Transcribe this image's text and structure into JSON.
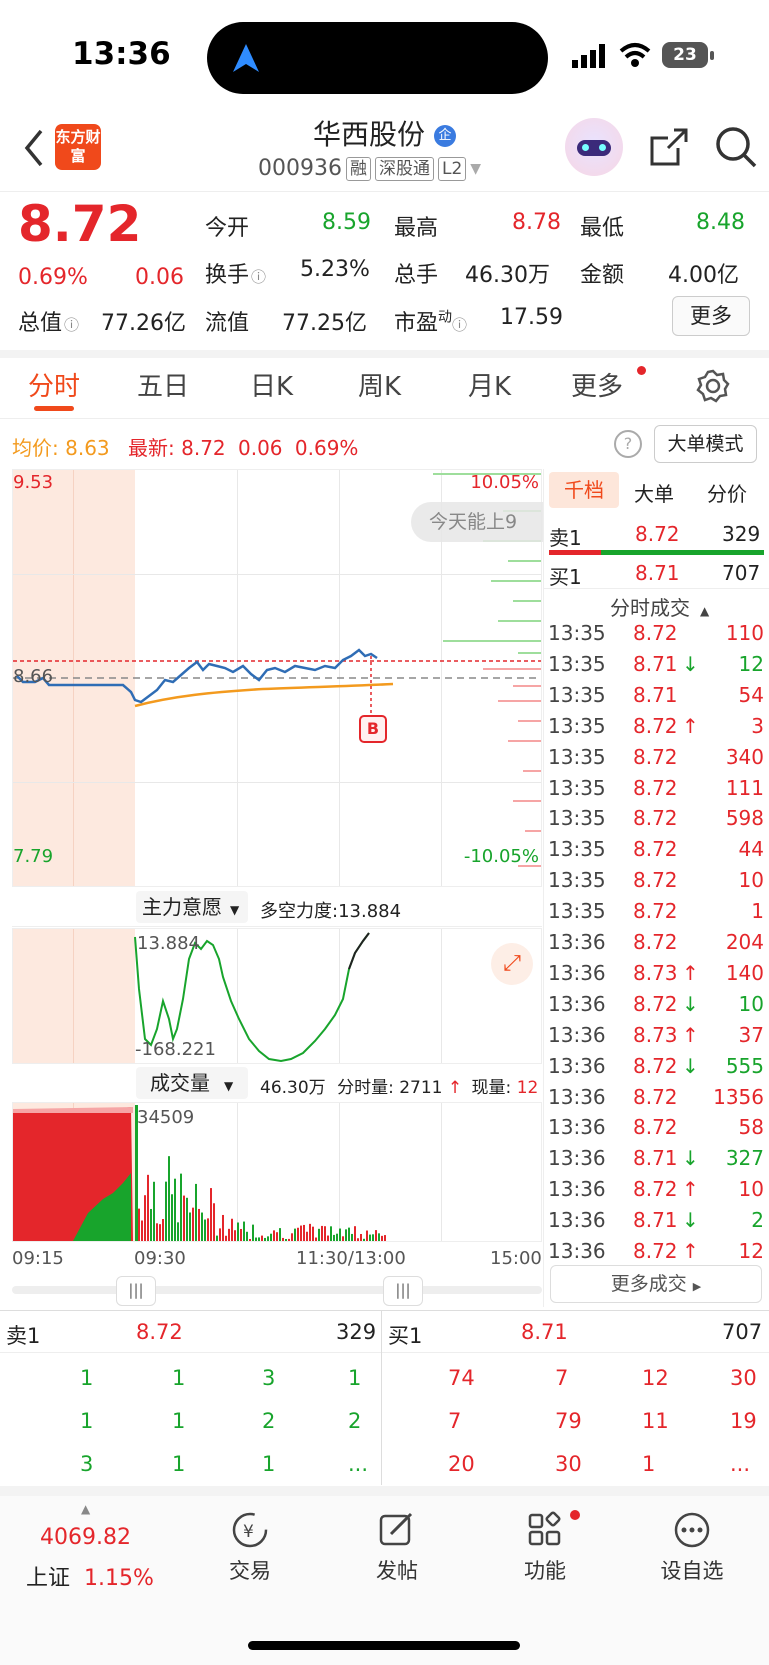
{
  "status_bar": {
    "time": "13:36",
    "battery": "23"
  },
  "header": {
    "logo": "东方财富",
    "stock_name": "华西股份",
    "stock_code": "000936",
    "tags": [
      "融",
      "深股通",
      "L2"
    ]
  },
  "quote": {
    "price": "8.72",
    "change_pct": "0.69%",
    "change": "0.06",
    "open_label": "今开",
    "open": "8.59",
    "high_label": "最高",
    "high": "8.78",
    "low_label": "最低",
    "low": "8.48",
    "turnover_label": "换手",
    "turnover": "5.23%",
    "volume_label": "总手",
    "volume": "46.30万",
    "amount_label": "金额",
    "amount": "4.00亿",
    "mcap_label": "总值",
    "mcap": "77.26亿",
    "float_label": "流值",
    "float_cap": "77.25亿",
    "pe_label": "市盈",
    "pe_sup": "动",
    "pe": "17.59",
    "more_button": "更多"
  },
  "tabs": [
    "分时",
    "五日",
    "日K",
    "周K",
    "月K",
    "更多"
  ],
  "chart_info": {
    "avg_label": "均价:",
    "avg": "8.63",
    "latest_label": "最新:",
    "latest": "8.72",
    "latest_change": "0.06",
    "latest_pct": "0.69%",
    "big_order_mode": "大单模式",
    "y_high": "9.53",
    "y_low": "7.79",
    "y_ref": "8.66",
    "pct_high": "10.05%",
    "pct_low": "-10.05%",
    "toast": "今天能上9",
    "marker": "B"
  },
  "indicator": {
    "selector": "主力意愿",
    "label": "多空力度:",
    "value": "13.884",
    "axis_high": "13.884",
    "axis_low": "-168.221"
  },
  "volume": {
    "selector": "成交量",
    "total": "46.30万",
    "minute_label": "分时量:",
    "minute_vol": "2711",
    "current_label": "现量:",
    "current": "12",
    "axis_high": "34509"
  },
  "time_axis": [
    "09:15",
    "09:30",
    "11:30/13:00",
    "15:00"
  ],
  "side_panel": {
    "tabs": [
      "千档",
      "大单",
      "分价"
    ],
    "sell1": {
      "label": "卖1",
      "price": "8.72",
      "vol": "329"
    },
    "buy1": {
      "label": "买1",
      "price": "8.71",
      "vol": "707"
    },
    "trades_title": "分时成交",
    "trades": [
      {
        "time": "13:35",
        "price": "8.72",
        "dir": "",
        "vol": "110"
      },
      {
        "time": "13:35",
        "price": "8.71",
        "dir": "↓",
        "vol": "12"
      },
      {
        "time": "13:35",
        "price": "8.71",
        "dir": "",
        "vol": "54"
      },
      {
        "time": "13:35",
        "price": "8.72",
        "dir": "↑",
        "vol": "3"
      },
      {
        "time": "13:35",
        "price": "8.72",
        "dir": "",
        "vol": "340"
      },
      {
        "time": "13:35",
        "price": "8.72",
        "dir": "",
        "vol": "111"
      },
      {
        "time": "13:35",
        "price": "8.72",
        "dir": "",
        "vol": "598"
      },
      {
        "time": "13:35",
        "price": "8.72",
        "dir": "",
        "vol": "44"
      },
      {
        "time": "13:35",
        "price": "8.72",
        "dir": "",
        "vol": "10"
      },
      {
        "time": "13:35",
        "price": "8.72",
        "dir": "",
        "vol": "1"
      },
      {
        "time": "13:36",
        "price": "8.72",
        "dir": "",
        "vol": "204"
      },
      {
        "time": "13:36",
        "price": "8.73",
        "dir": "↑",
        "vol": "140"
      },
      {
        "time": "13:36",
        "price": "8.72",
        "dir": "↓",
        "vol": "10"
      },
      {
        "time": "13:36",
        "price": "8.73",
        "dir": "↑",
        "vol": "37"
      },
      {
        "time": "13:36",
        "price": "8.72",
        "dir": "↓",
        "vol": "555"
      },
      {
        "time": "13:36",
        "price": "8.72",
        "dir": "",
        "vol": "1356"
      },
      {
        "time": "13:36",
        "price": "8.72",
        "dir": "",
        "vol": "58"
      },
      {
        "time": "13:36",
        "price": "8.71",
        "dir": "↓",
        "vol": "327"
      },
      {
        "time": "13:36",
        "price": "8.72",
        "dir": "↑",
        "vol": "10"
      },
      {
        "time": "13:36",
        "price": "8.71",
        "dir": "↓",
        "vol": "2"
      },
      {
        "time": "13:36",
        "price": "8.72",
        "dir": "↑",
        "vol": "12"
      }
    ],
    "more_trades": "更多成交"
  },
  "order_book": {
    "sell_label": "卖1",
    "sell_price": "8.72",
    "sell_vol": "329",
    "buy_label": "买1",
    "buy_price": "8.71",
    "buy_vol": "707",
    "sell_rows": [
      [
        "1",
        "1",
        "3",
        "1"
      ],
      [
        "1",
        "1",
        "2",
        "2"
      ],
      [
        "3",
        "1",
        "1",
        "..."
      ]
    ],
    "buy_rows": [
      [
        "74",
        "7",
        "12",
        "30"
      ],
      [
        "7",
        "79",
        "11",
        "19"
      ],
      [
        "20",
        "30",
        "1",
        "..."
      ]
    ]
  },
  "bottom_nav": {
    "index_value": "4069.82",
    "index_name": "上证",
    "index_pct": "1.15%",
    "items": [
      "交易",
      "发帖",
      "功能",
      "设自选"
    ]
  },
  "colors": {
    "up": "#e4262b",
    "down": "#18a42c",
    "accent": "#f0491b",
    "price_line": "#2f6db5",
    "avg_line": "#f39a1e"
  }
}
